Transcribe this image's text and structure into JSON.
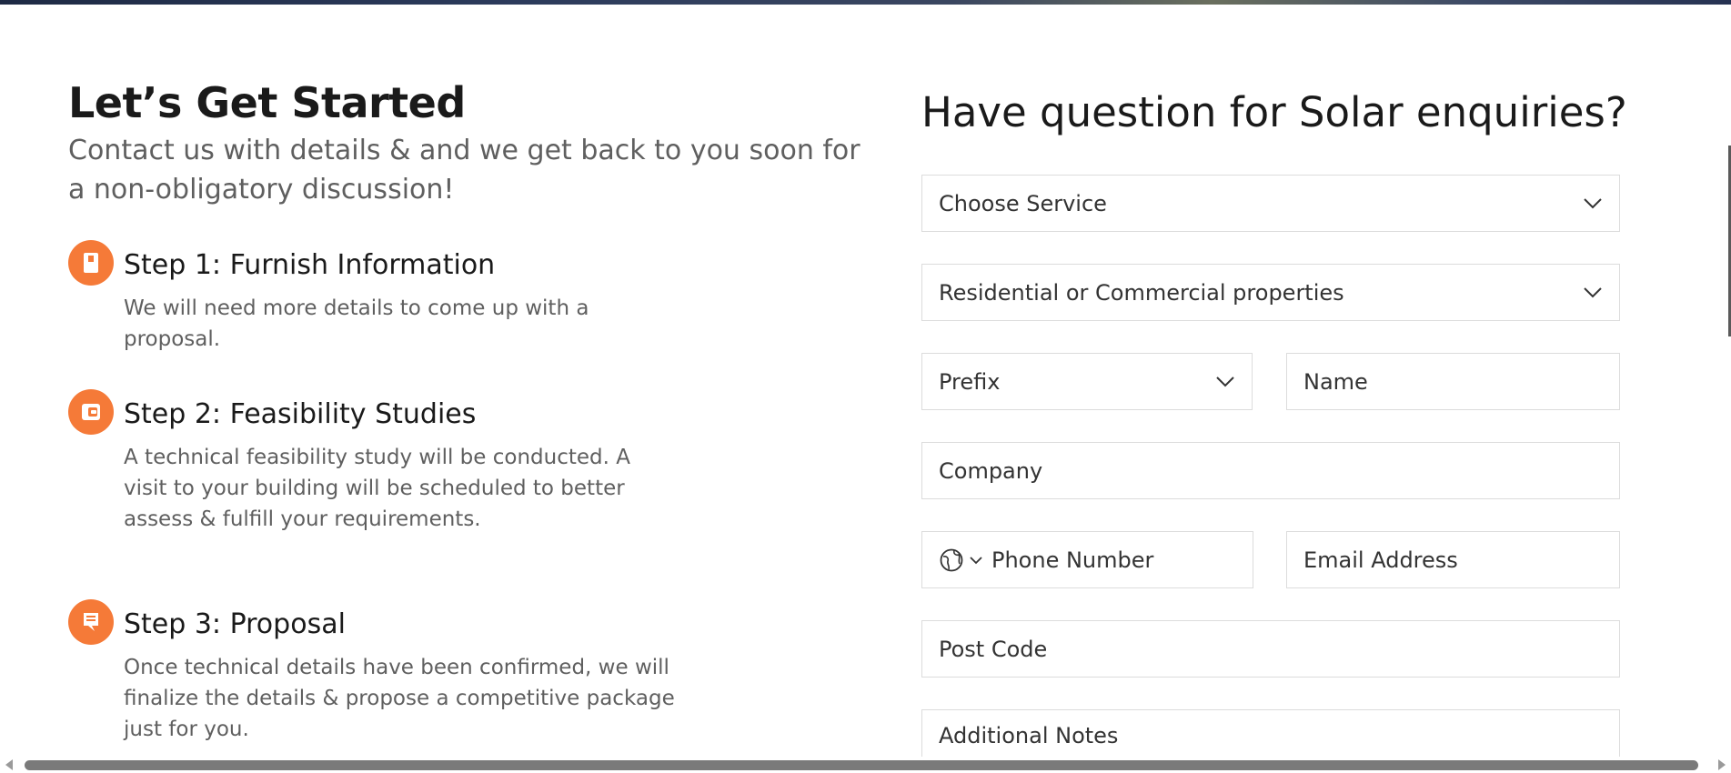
{
  "intro": {
    "heading": "Let’s Get Started",
    "subheading": "Contact us with details & and we get back to you soon for a non-obligatory discussion!"
  },
  "steps": [
    {
      "title": "Step 1: Furnish Information",
      "description": "We will need more details to come up with a proposal.",
      "icon": "document-icon"
    },
    {
      "title": "Step 2: Feasibility Studies",
      "description": "A technical feasibility study will be conducted. A visit to your building will be scheduled to better assess & fulfill your requirements.",
      "icon": "wallet-icon"
    },
    {
      "title": "Step 3: Proposal",
      "description": "Once technical details have been confirmed, we will finalize the details & propose a competitive package just for you.",
      "icon": "proposal-icon"
    }
  ],
  "form": {
    "title": "Have question for Solar enquiries?",
    "service_select": "Choose Service",
    "property_select": "Residential or Commercial properties",
    "prefix_select": "Prefix",
    "name_placeholder": "Name",
    "company_placeholder": "Company",
    "phone_placeholder": "Phone Number",
    "email_placeholder": "Email Address",
    "postcode_placeholder": "Post Code",
    "notes_placeholder": "Additional Notes"
  },
  "colors": {
    "accent": "#f57a38",
    "text_dark": "#1a1a1a",
    "text_muted": "#5f5f5f",
    "field_border": "#dcdcdc"
  }
}
